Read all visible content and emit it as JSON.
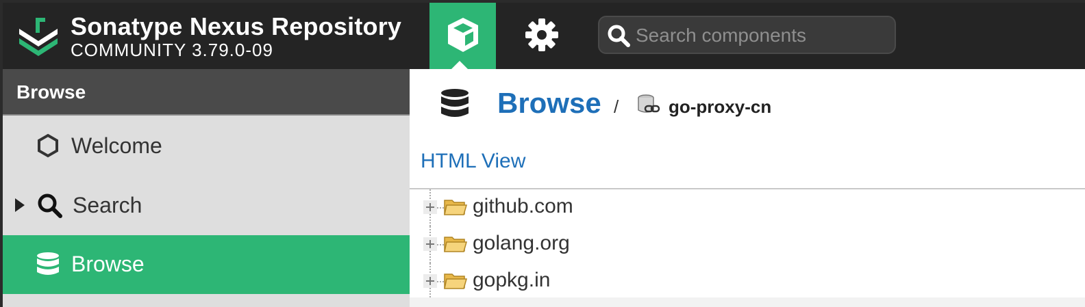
{
  "header": {
    "title": "Sonatype Nexus Repository",
    "edition": "COMMUNITY 3.79.0-09",
    "modes": [
      {
        "name": "browse",
        "icon": "cube-icon",
        "active": true
      },
      {
        "name": "administration",
        "icon": "gear-icon",
        "active": false
      }
    ],
    "search": {
      "placeholder": "Search components",
      "value": ""
    }
  },
  "sidebar": {
    "title": "Browse",
    "items": [
      {
        "label": "Welcome",
        "icon": "hexagon-icon",
        "active": false
      },
      {
        "label": "Search",
        "icon": "search-icon",
        "active": false,
        "collapsed": true
      },
      {
        "label": "Browse",
        "icon": "database-icon",
        "active": true
      }
    ]
  },
  "main": {
    "title": "Browse",
    "separator": "/",
    "repository": "go-proxy-cn",
    "html_view_label": "HTML View",
    "tree": [
      {
        "name": "github.com",
        "icon": "folder-open-icon"
      },
      {
        "name": "golang.org",
        "icon": "folder-open-icon"
      },
      {
        "name": "gopkg.in",
        "icon": "folder-open-icon"
      }
    ]
  },
  "colors": {
    "accent": "#2db675",
    "header_bg": "#242424",
    "link": "#1e6fb8",
    "sidebar_bg": "#dedede"
  }
}
